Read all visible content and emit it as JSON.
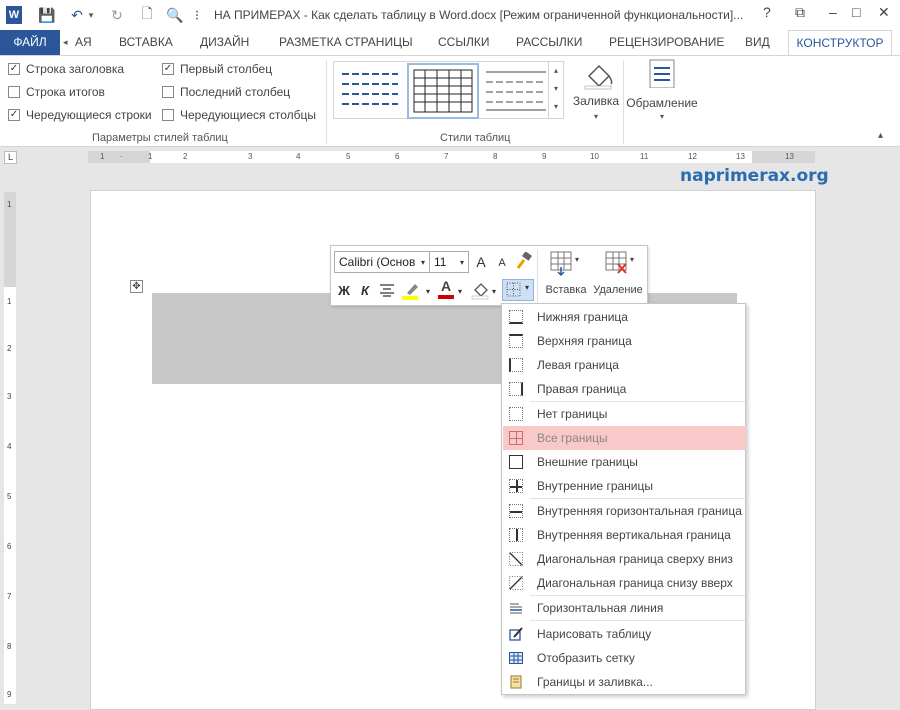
{
  "title": "НА ПРИМЕРАХ - Как сделать таблицу в Word.docx [Режим ограниченной функциональности]...",
  "window_controls": {
    "help": "?",
    "restore": "⧉",
    "minimize": "–",
    "maximize": "□",
    "close": "✕"
  },
  "qat": {
    "word_icon": "W",
    "save": "💾",
    "undo": "↶",
    "redo": "↻",
    "new": "🗋",
    "preview": "🔍",
    "customize": "⁝"
  },
  "tabs": {
    "file": "ФАЙЛ",
    "scroll_left": "◂",
    "partial": "АЯ",
    "items": [
      "ВСТАВКА",
      "ДИЗАЙН",
      "РАЗМЕТКА СТРАНИЦЫ",
      "ССЫЛКИ",
      "РАССЫЛКИ",
      "РЕЦЕНЗИРОВАНИЕ",
      "ВИД"
    ],
    "active": "КОНСТРУКТОР"
  },
  "ribbon": {
    "options": [
      {
        "label": "Строка заголовка",
        "checked": true
      },
      {
        "label": "Строка итогов",
        "checked": false
      },
      {
        "label": "Чередующиеся строки",
        "checked": true
      },
      {
        "label": "Первый столбец",
        "checked": true
      },
      {
        "label": "Последний столбец",
        "checked": false
      },
      {
        "label": "Чередующиеся столбцы",
        "checked": false
      }
    ],
    "check_mark": "✓",
    "group_options_label": "Параметры стилей таблиц",
    "group_styles_label": "Стили таблиц",
    "fill_label": "Заливка",
    "borders_label": "Обрамление",
    "dropdown_arrow": "▾",
    "collapse": "▴"
  },
  "ruler": {
    "h_ticks": [
      "1",
      "2",
      "1",
      "2",
      "3",
      "4",
      "5",
      "6",
      "7",
      "8",
      "9",
      "10",
      "11",
      "12",
      "13"
    ],
    "corner": "L",
    "v_ticks": [
      "1",
      "1",
      "2",
      "3",
      "4",
      "5",
      "6",
      "7",
      "8",
      "9"
    ]
  },
  "watermark": "naprimerax.org",
  "table_move_handle": "✥",
  "minibar": {
    "font": "Calibri (Основ",
    "size": "11",
    "grow": "A",
    "shrink": "A",
    "bold": "Ж",
    "italic": "К",
    "insert_label": "Вставка",
    "delete_label": "Удаление",
    "highlight_color": "#ffff00",
    "font_color": "#d00000"
  },
  "menu": {
    "items": [
      {
        "label": "Нижняя граница",
        "icon": "border-bottom-icon"
      },
      {
        "label": "Верхняя граница",
        "icon": "border-top-icon"
      },
      {
        "label": "Левая граница",
        "icon": "border-left-icon"
      },
      {
        "label": "Правая граница",
        "icon": "border-right-icon"
      },
      {
        "label": "Нет границы",
        "icon": "border-none-icon"
      },
      {
        "label": "Все границы",
        "icon": "border-all-icon",
        "highlighted": true
      },
      {
        "label": "Внешние границы",
        "icon": "border-outside-icon"
      },
      {
        "label": "Внутренние границы",
        "icon": "border-inside-icon"
      },
      {
        "label": "Внутренняя горизонтальная граница",
        "icon": "border-inside-h-icon"
      },
      {
        "label": "Внутренняя вертикальная граница",
        "icon": "border-inside-v-icon"
      },
      {
        "label": "Диагональная граница сверху вниз",
        "icon": "diag-down-icon"
      },
      {
        "label": "Диагональная граница снизу вверх",
        "icon": "diag-up-icon"
      },
      {
        "label": "Горизонтальная линия",
        "icon": "horizontal-line-icon"
      },
      {
        "label": "Нарисовать таблицу",
        "icon": "draw-table-icon"
      },
      {
        "label": "Отобразить сетку",
        "icon": "view-gridlines-icon"
      },
      {
        "label": "Границы и заливка...",
        "icon": "borders-shading-icon"
      }
    ]
  },
  "colors": {
    "accent": "#2b579a",
    "highlight": "#f9c8c8",
    "watermark": "#2b6cb0"
  }
}
